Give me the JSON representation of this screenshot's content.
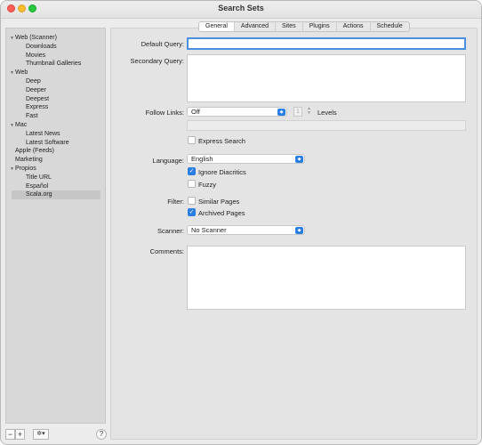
{
  "window": {
    "title": "Search Sets"
  },
  "sidebar": {
    "items": [
      {
        "label": "Web (Scanner)",
        "level": 0,
        "expanded": true,
        "selected": false
      },
      {
        "label": "Downloads",
        "level": 1,
        "selected": false
      },
      {
        "label": "Movies",
        "level": 1,
        "selected": false
      },
      {
        "label": "Thumbnail Galleries",
        "level": 1,
        "selected": false
      },
      {
        "label": "Web",
        "level": 0,
        "expanded": true,
        "selected": false
      },
      {
        "label": "Deep",
        "level": 1,
        "selected": false
      },
      {
        "label": "Deeper",
        "level": 1,
        "selected": false
      },
      {
        "label": "Deepest",
        "level": 1,
        "selected": false
      },
      {
        "label": "Express",
        "level": 1,
        "selected": false
      },
      {
        "label": "Fast",
        "level": 1,
        "selected": false
      },
      {
        "label": "Mac",
        "level": 0,
        "expanded": true,
        "selected": false
      },
      {
        "label": "Latest News",
        "level": 1,
        "selected": false
      },
      {
        "label": "Latest Software",
        "level": 1,
        "selected": false
      },
      {
        "label": "Apple (Feeds)",
        "level": 0,
        "selected": false
      },
      {
        "label": "Marketing",
        "level": 0,
        "selected": false
      },
      {
        "label": "Propios",
        "level": 0,
        "expanded": true,
        "selected": false
      },
      {
        "label": "Title URL",
        "level": 1,
        "selected": false
      },
      {
        "label": "Español",
        "level": 1,
        "selected": false
      },
      {
        "label": "Scala.org",
        "level": 1,
        "selected": true
      }
    ],
    "remove_label": "−",
    "add_label": "+",
    "action_label": "✲▾",
    "help_label": "?"
  },
  "tabs": [
    "General",
    "Advanced",
    "Sites",
    "Plugins",
    "Actions",
    "Schedule"
  ],
  "form": {
    "default_query_label": "Default Query:",
    "default_query_value": "",
    "secondary_query_label": "Secondary Query:",
    "follow_links_label": "Follow Links:",
    "follow_links_value": "Off",
    "levels_value": "1",
    "levels_label": "Levels",
    "express_search_label": "Express Search",
    "language_label": "Language:",
    "language_value": "English",
    "ignore_diacritics_label": "Ignore Diacritics",
    "fuzzy_label": "Fuzzy",
    "filter_label": "Filter:",
    "similar_pages_label": "Similar Pages",
    "archived_pages_label": "Archived Pages",
    "scanner_label": "Scanner:",
    "scanner_value": "No Scanner",
    "comments_label": "Comments:"
  },
  "colors": {
    "accent": "#2a7de1",
    "selection": "#c6c6c6"
  }
}
